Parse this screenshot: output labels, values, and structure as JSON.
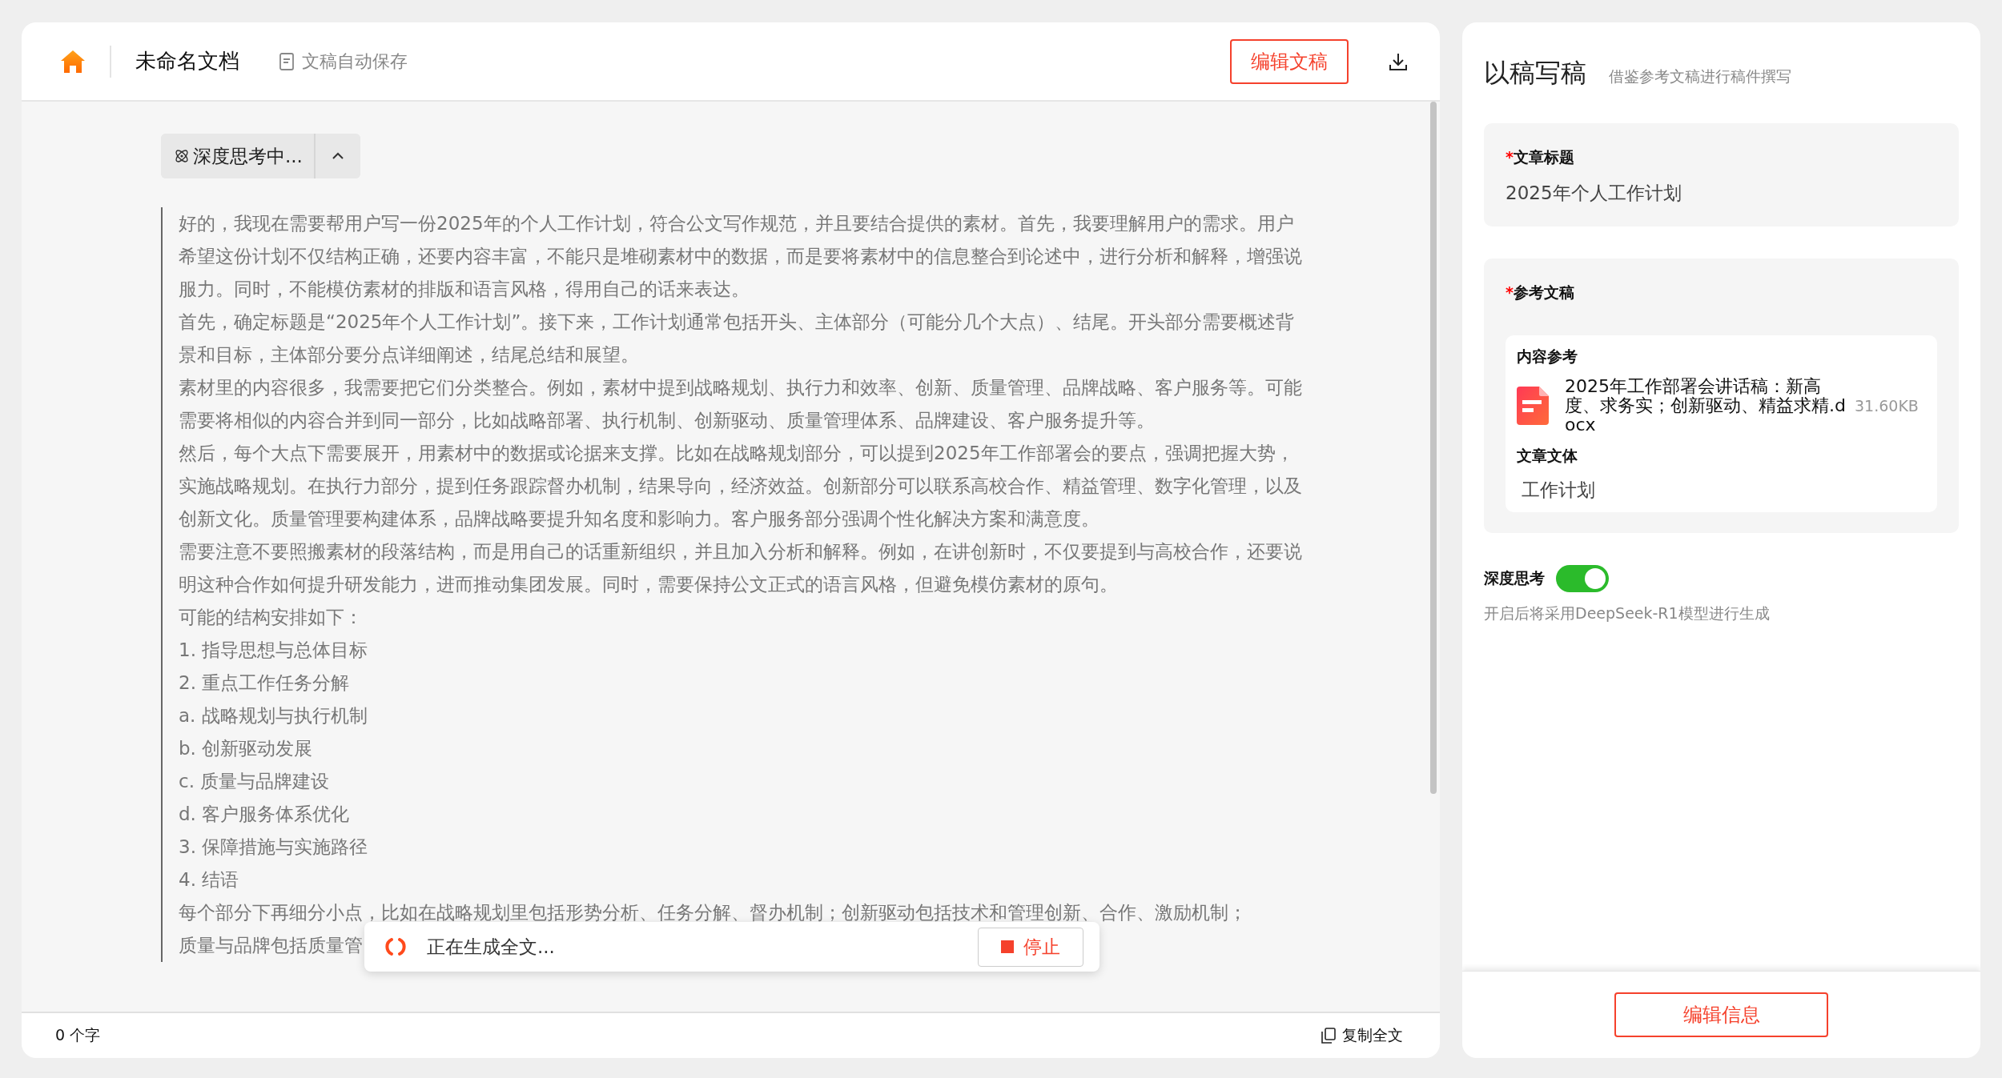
{
  "header": {
    "title": "未命名文档",
    "autosave": "文稿自动保存",
    "edit_button": "编辑文稿"
  },
  "thinking": {
    "label": "深度思考中...",
    "expanded": true,
    "paragraphs": [
      "好的，我现在需要帮用户写一份2025年的个人工作计划，符合公文写作规范，并且要结合提供的素材。首先，我要理解用户的需求。用户希望这份计划不仅结构正确，还要内容丰富，不能只是堆砌素材中的数据，而是要将素材中的信息整合到论述中，进行分析和解释，增强说服力。同时，不能模仿素材的排版和语言风格，得用自己的话来表达。",
      "首先，确定标题是“2025年个人工作计划”。接下来，工作计划通常包括开头、主体部分（可能分几个大点）、结尾。开头部分需要概述背景和目标，主体部分要分点详细阐述，结尾总结和展望。",
      "素材里的内容很多，我需要把它们分类整合。例如，素材中提到战略规划、执行力和效率、创新、质量管理、品牌战略、客户服务等。可能需要将相似的内容合并到同一部分，比如战略部署、执行机制、创新驱动、质量管理体系、品牌建设、客户服务提升等。",
      "然后，每个大点下需要展开，用素材中的数据或论据来支撑。比如在战略规划部分，可以提到2025年工作部署会的要点，强调把握大势，实施战略规划。在执行力部分，提到任务跟踪督办机制，结果导向，经济效益。创新部分可以联系高校合作、精益管理、数字化管理，以及创新文化。质量管理要构建体系，品牌战略要提升知名度和影响力。客户服务部分强调个性化解决方案和满意度。",
      "需要注意不要照搬素材的段落结构，而是用自己的话重新组织，并且加入分析和解释。例如，在讲创新时，不仅要提到与高校合作，还要说明这种合作如何提升研发能力，进而推动集团发展。同时，需要保持公文正式的语言风格，但避免模仿素材的原句。",
      "可能的结构安排如下：",
      "1. 指导思想与总体目标",
      "2. 重点工作任务分解",
      "a. 战略规划与执行机制",
      "b. 创新驱动发展",
      "c. 质量与品牌建设",
      "d. 客户服务体系优化",
      "3. 保障措施与实施路径",
      "4. 结语",
      "每个部分下再细分小点，比如在战略规划里包括形势分析、任务分解、督办机制；创新驱动包括技术和管理创新、合作、激励机制；",
      "质量与品牌包括质量管"
    ]
  },
  "generating": {
    "text": "正在生成全文...",
    "stop_button": "停止"
  },
  "footer": {
    "word_count": "0 个字",
    "copy_button": "复制全文"
  },
  "panel": {
    "title": "以稿写稿",
    "subtitle": "借鉴参考文稿进行稿件撰写",
    "title_field": {
      "mark": "*",
      "label": "文章标题",
      "value": "2025年个人工作计划"
    },
    "reference": {
      "mark": "*",
      "label": "参考文稿",
      "content_label": "内容参考",
      "file_name": "2025年工作部署会讲话稿：新高度、求务实；创新驱动、精益求精.docx",
      "file_size": "31.60KB",
      "genre_label": "文章文体",
      "genre": "工作计划"
    },
    "deep_thinking": {
      "label": "深度思考",
      "on": true,
      "hint": "开启后将采用DeepSeek-R1模型进行生成"
    },
    "edit_info_button": "编辑信息"
  }
}
